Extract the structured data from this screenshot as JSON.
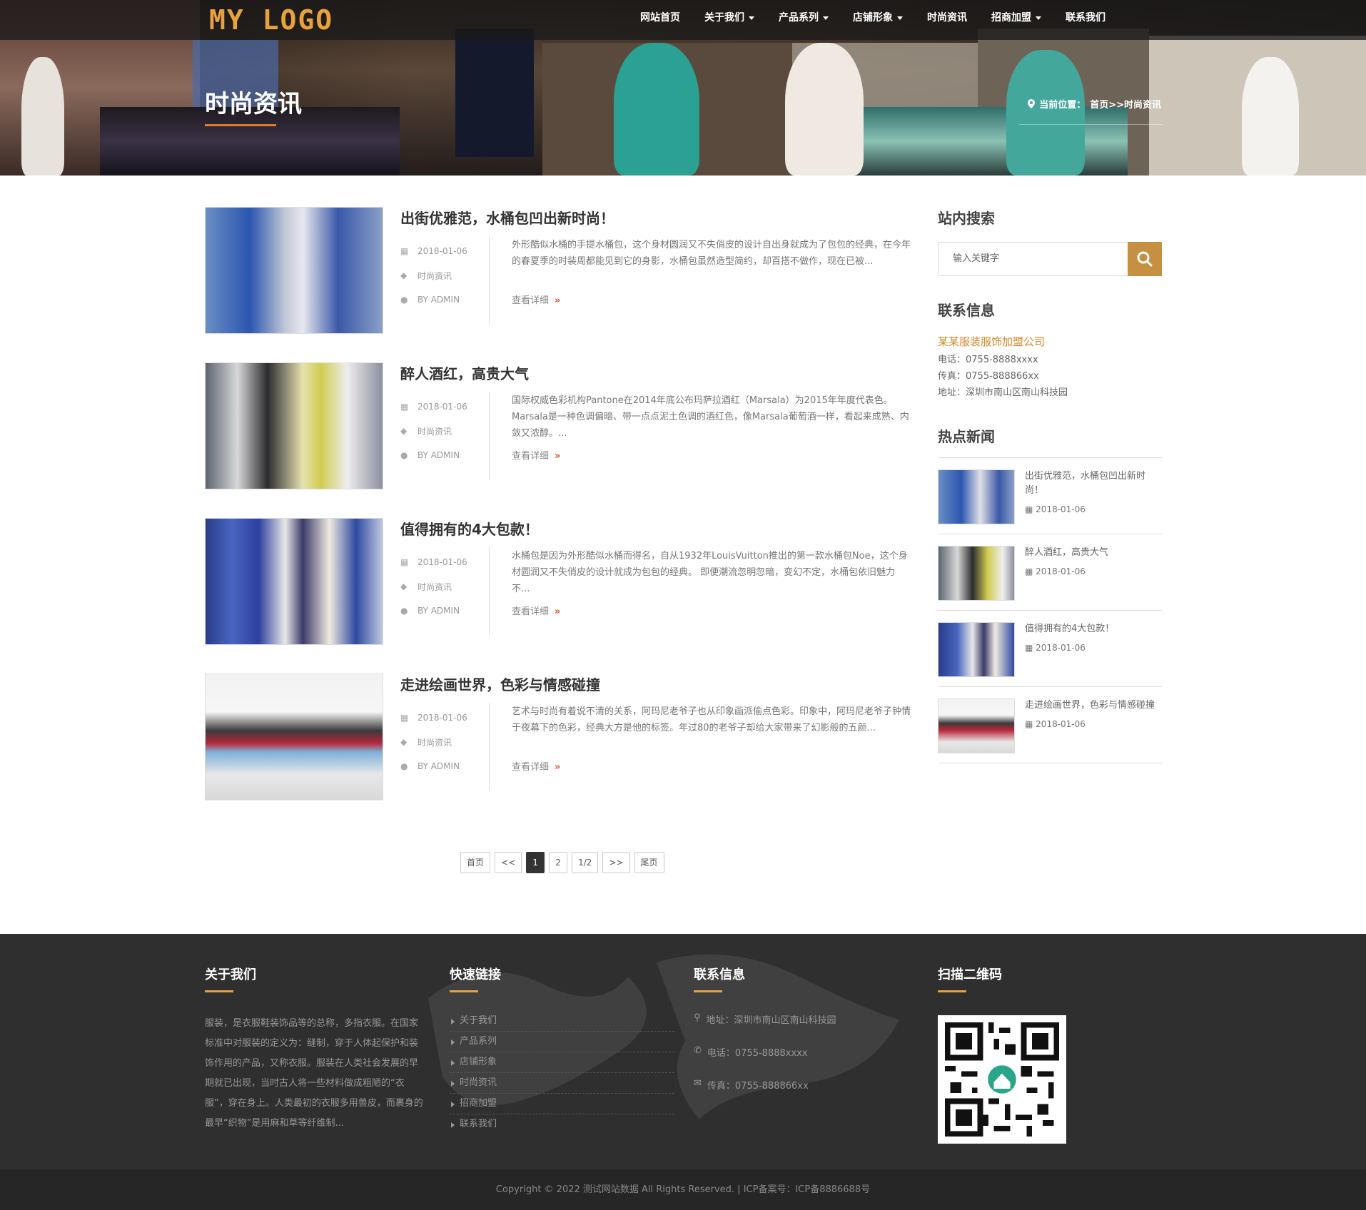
{
  "header": {
    "logo": "MY LOGO",
    "nav": [
      {
        "label": "网站首页",
        "dropdown": false
      },
      {
        "label": "关于我们",
        "dropdown": true
      },
      {
        "label": "产品系列",
        "dropdown": true
      },
      {
        "label": "店铺形象",
        "dropdown": true
      },
      {
        "label": "时尚资讯",
        "dropdown": false
      },
      {
        "label": "招商加盟",
        "dropdown": true
      },
      {
        "label": "联系我们",
        "dropdown": false
      }
    ]
  },
  "banner": {
    "title": "时尚资讯",
    "breadcrumb_prefix": "当前位置：",
    "breadcrumb_path": "首页>>时尚资讯"
  },
  "posts": [
    {
      "title": "出街优雅范，水桶包凹出新时尚！",
      "date": "2018-01-06",
      "category": "时尚资讯",
      "author": "BY ADMIN",
      "excerpt": "外形酷似水桶的手提水桶包，这个身材圆润又不失俏皮的设计自出身就成为了包包的经典，在今年的春夏季的时装周都能见到它的身影，水桶包虽然造型简约，却百搭不做作，现在已被...",
      "more": "查看详细"
    },
    {
      "title": "醉人酒红，高贵大气",
      "date": "2018-01-06",
      "category": "时尚资讯",
      "author": "BY ADMIN",
      "excerpt": "国际权威色彩机构Pantone在2014年底公布玛萨拉酒红（Marsala）为2015年年度代表色。Marsala是一种色调偏暗、带一点点泥土色调的酒红色，像Marsala葡萄酒一样，看起来成熟、内敛又浓醇。...",
      "more": "查看详细"
    },
    {
      "title": "值得拥有的4大包款！",
      "date": "2018-01-06",
      "category": "时尚资讯",
      "author": "BY ADMIN",
      "excerpt": "水桶包是因为外形酷似水桶而得名，自从1932年LouisVuitton推出的第一款水桶包Noe，这个身材圆润又不失俏皮的设计就成为包包的经典。 即便潮流忽明忽暗，变幻不定，水桶包依旧魅力不...",
      "more": "查看详细"
    },
    {
      "title": "走进绘画世界，色彩与情感碰撞",
      "date": "2018-01-06",
      "category": "时尚资讯",
      "author": "BY ADMIN",
      "excerpt": "艺术与时尚有着说不清的关系，阿玛尼老爷子也从印象画派偷点色彩。印象中，阿玛尼老爷子钟情于夜幕下的色彩，经典大方是他的标签。年过80的老爷子却给大家带来了幻影般的五颜...",
      "more": "查看详细"
    }
  ],
  "pagination": [
    "首页",
    "<<",
    "1",
    "2",
    "1/2",
    ">>",
    "尾页"
  ],
  "sidebar": {
    "search_title": "站内搜索",
    "search_placeholder": "输入关键字",
    "contact_title": "联系信息",
    "company": "某某服装服饰加盟公司",
    "phone": "电话：0755-8888xxxx",
    "fax": "传真：0755-888866xx",
    "address": "地址：深圳市南山区南山科技园",
    "hot_title": "热点新闻",
    "hot": [
      {
        "title": "出街优雅范，水桶包凹出新时尚！",
        "date": "2018-01-06"
      },
      {
        "title": "醉人酒红，高贵大气",
        "date": "2018-01-06"
      },
      {
        "title": "值得拥有的4大包款！",
        "date": "2018-01-06"
      },
      {
        "title": "走进绘画世界，色彩与情感碰撞",
        "date": "2018-01-06"
      }
    ]
  },
  "footer": {
    "about_title": "关于我们",
    "about_text": "服装，是衣服鞋装饰品等的总称，多指衣服。在国家标准中对服装的定义为：缝制，穿于人体起保护和装饰作用的产品，又称衣服。服装在人类社会发展的早期就已出现，当时古人将一些材料做成粗陋的“衣服”，穿在身上。人类最初的衣服多用兽皮，而裹身的最早“织物”是用麻和草等纤维制...",
    "links_title": "快速链接",
    "links": [
      "关于我们",
      "产品系列",
      "店铺形象",
      "时尚资讯",
      "招商加盟",
      "联系我们"
    ],
    "contact_title": "联系信息",
    "address": "地址：深圳市南山区南山科技园",
    "phone": "电话：0755-8888xxxx",
    "fax": "传真：0755-888866xx",
    "qr_title": "扫描二维码",
    "copyright": "Copyright © 2022 测试网站数据 All Rights Reserved. | ICP备案号：ICP备8886688号"
  },
  "colors": {
    "accent": "#e8a13c",
    "search_btn": "#c69042",
    "company": "#d4892e",
    "more_arrow": "#e0522b"
  }
}
